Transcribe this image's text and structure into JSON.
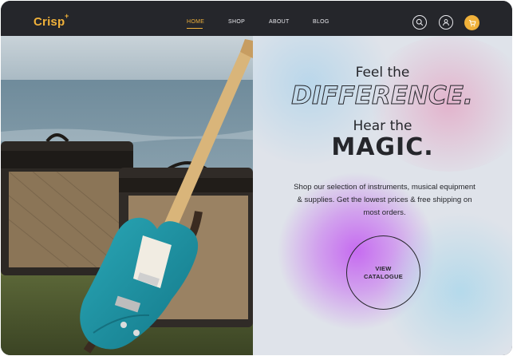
{
  "brand": {
    "logo_text": "Crisp",
    "logo_mark": "+",
    "accent_color": "#f0b13a",
    "nav_background": "#25262b"
  },
  "nav": {
    "links": [
      {
        "label": "HOME",
        "active": true
      },
      {
        "label": "SHOP",
        "active": false
      },
      {
        "label": "ABOUT",
        "active": false
      },
      {
        "label": "BLOG",
        "active": false
      }
    ],
    "icons": [
      "search-icon",
      "user-icon",
      "cart-icon"
    ]
  },
  "hero": {
    "image": "electric-guitar-leaning-on-amplifiers-photo",
    "line1": "Feel the",
    "line2": "DIFFERENCE.",
    "line3": "Hear the",
    "line4": "MAGIC.",
    "description_lines": [
      "Shop our selection of instruments, musical equipment",
      "& supplies. Get the lowest prices & free shipping on",
      "most orders."
    ],
    "cta_line1": "VIEW",
    "cta_line2": "CATALOGUE"
  }
}
